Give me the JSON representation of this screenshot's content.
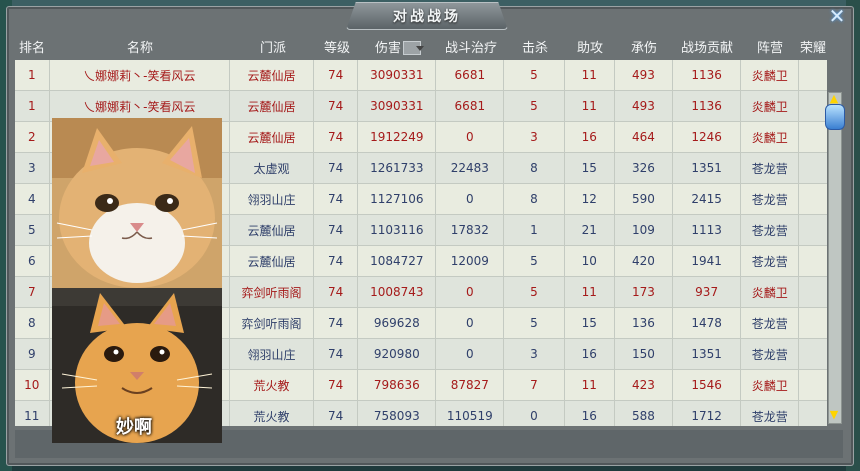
{
  "window": {
    "title": "对战战场",
    "close_symbol": "✕"
  },
  "table": {
    "headers": [
      "排名",
      "名称",
      "门派",
      "等级",
      "伤害",
      "战斗治疗",
      "击杀",
      "助攻",
      "承伤",
      "战场贡献",
      "阵营",
      "荣耀"
    ],
    "rows": [
      {
        "rank": "1",
        "name": "乀娜娜莉丶-笑看风云",
        "school": "云麓仙居",
        "level": "74",
        "damage": "3090331",
        "heal": "6681",
        "kills": "5",
        "assists": "11",
        "taken": "493",
        "contrib": "1136",
        "camp": "炎麟卫",
        "honor": "",
        "tone": "red"
      },
      {
        "rank": "1",
        "name": "乀娜娜莉丶-笑看风云",
        "school": "云麓仙居",
        "level": "74",
        "damage": "3090331",
        "heal": "6681",
        "kills": "5",
        "assists": "11",
        "taken": "493",
        "contrib": "1136",
        "camp": "炎麟卫",
        "honor": "",
        "tone": "red"
      },
      {
        "rank": "2",
        "name": "",
        "school": "云麓仙居",
        "level": "74",
        "damage": "1912249",
        "heal": "0",
        "kills": "3",
        "assists": "16",
        "taken": "464",
        "contrib": "1246",
        "camp": "炎麟卫",
        "honor": "",
        "tone": "red"
      },
      {
        "rank": "3",
        "name": "",
        "school": "太虚观",
        "level": "74",
        "damage": "1261733",
        "heal": "22483",
        "kills": "8",
        "assists": "15",
        "taken": "326",
        "contrib": "1351",
        "camp": "苍龙营",
        "honor": "",
        "tone": "blue"
      },
      {
        "rank": "4",
        "name": "",
        "school": "翎羽山庄",
        "level": "74",
        "damage": "1127106",
        "heal": "0",
        "kills": "8",
        "assists": "12",
        "taken": "590",
        "contrib": "2415",
        "camp": "苍龙营",
        "honor": "",
        "tone": "blue"
      },
      {
        "rank": "5",
        "name": "",
        "school": "云麓仙居",
        "level": "74",
        "damage": "1103116",
        "heal": "17832",
        "kills": "1",
        "assists": "21",
        "taken": "109",
        "contrib": "1113",
        "camp": "苍龙营",
        "honor": "",
        "tone": "blue"
      },
      {
        "rank": "6",
        "name": "",
        "school": "云麓仙居",
        "level": "74",
        "damage": "1084727",
        "heal": "12009",
        "kills": "5",
        "assists": "10",
        "taken": "420",
        "contrib": "1941",
        "camp": "苍龙营",
        "honor": "",
        "tone": "blue"
      },
      {
        "rank": "7",
        "name": "",
        "school": "弈剑听雨阁",
        "level": "74",
        "damage": "1008743",
        "heal": "0",
        "kills": "5",
        "assists": "11",
        "taken": "173",
        "contrib": "937",
        "camp": "炎麟卫",
        "honor": "",
        "tone": "red"
      },
      {
        "rank": "8",
        "name": "",
        "school": "弈剑听雨阁",
        "level": "74",
        "damage": "969628",
        "heal": "0",
        "kills": "5",
        "assists": "15",
        "taken": "136",
        "contrib": "1478",
        "camp": "苍龙营",
        "honor": "",
        "tone": "blue"
      },
      {
        "rank": "9",
        "name": "",
        "school": "翎羽山庄",
        "level": "74",
        "damage": "920980",
        "heal": "0",
        "kills": "3",
        "assists": "16",
        "taken": "150",
        "contrib": "1351",
        "camp": "苍龙营",
        "honor": "",
        "tone": "blue"
      },
      {
        "rank": "10",
        "name": "",
        "school": "荒火教",
        "level": "74",
        "damage": "798636",
        "heal": "87827",
        "kills": "7",
        "assists": "11",
        "taken": "423",
        "contrib": "1546",
        "camp": "炎麟卫",
        "honor": "",
        "tone": "red"
      },
      {
        "rank": "11",
        "name": "",
        "school": "荒火教",
        "level": "74",
        "damage": "758093",
        "heal": "110519",
        "kills": "0",
        "assists": "16",
        "taken": "588",
        "contrib": "1712",
        "camp": "苍龙营",
        "honor": "",
        "tone": "blue"
      }
    ]
  },
  "overlay": {
    "meme_text": "妙啊"
  },
  "colors": {
    "red_camp": "#a51a1a",
    "blue_camp": "#2f3f6a",
    "accent": "#3a7fd1"
  }
}
